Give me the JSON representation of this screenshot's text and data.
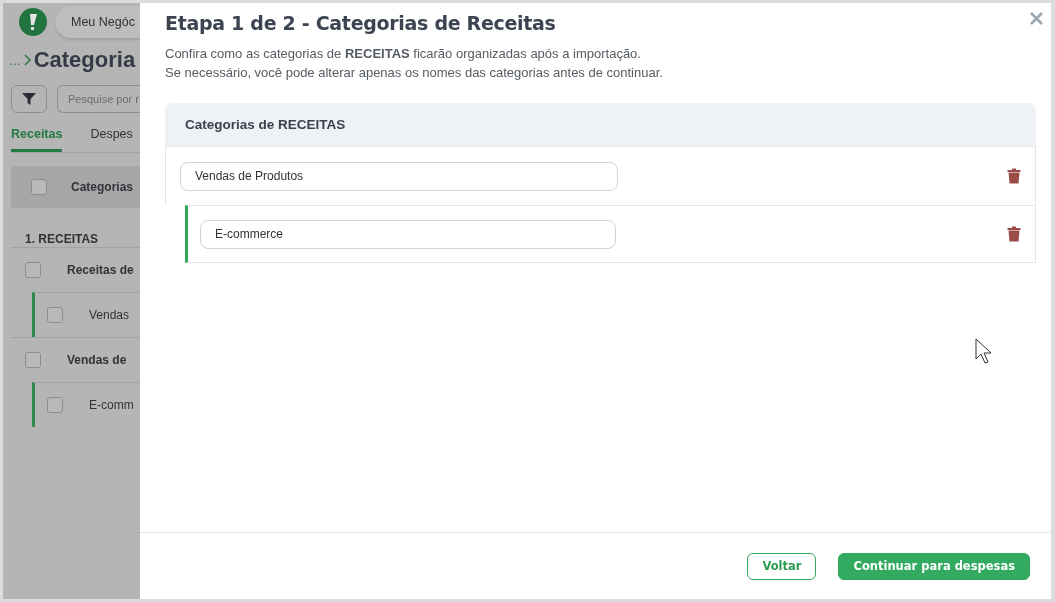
{
  "background": {
    "brand": "Meu Negóc",
    "breadcrumb": "...",
    "page_title": "Categoria",
    "search": {
      "placeholder": "Pesquise por r"
    },
    "tabs": [
      {
        "label": "Receitas",
        "selected": true
      },
      {
        "label": "Despes",
        "selected": false
      }
    ],
    "table": {
      "header": "Categorias",
      "header_checked": false,
      "group": "1. RECEITAS",
      "rows": [
        {
          "kind": "parent",
          "label": "Receitas de",
          "checked": false
        },
        {
          "kind": "child",
          "label": "Vendas",
          "checked": false
        },
        {
          "kind": "parent",
          "label": "Vendas de",
          "checked": false
        },
        {
          "kind": "child",
          "label": "E-comm",
          "checked": false
        }
      ]
    }
  },
  "modal": {
    "title": "Etapa 1 de 2 - Categorias de Receitas",
    "description": [
      "Confira como as categorias de **RECEITAS** ficarão organizadas após a importação.",
      "Se necessário, você pode alterar apenas os nomes das categorias antes de continuar."
    ],
    "panel": {
      "title": "Categorias de RECEITAS",
      "categories": [
        {
          "value": "Vendas de Produtos",
          "children": [
            {
              "value": "E-commerce"
            }
          ]
        }
      ]
    },
    "buttons": [
      {
        "kind": "secondary",
        "label": "Voltar"
      },
      {
        "kind": "primary",
        "label": "Continuar para despesas"
      }
    ]
  }
}
